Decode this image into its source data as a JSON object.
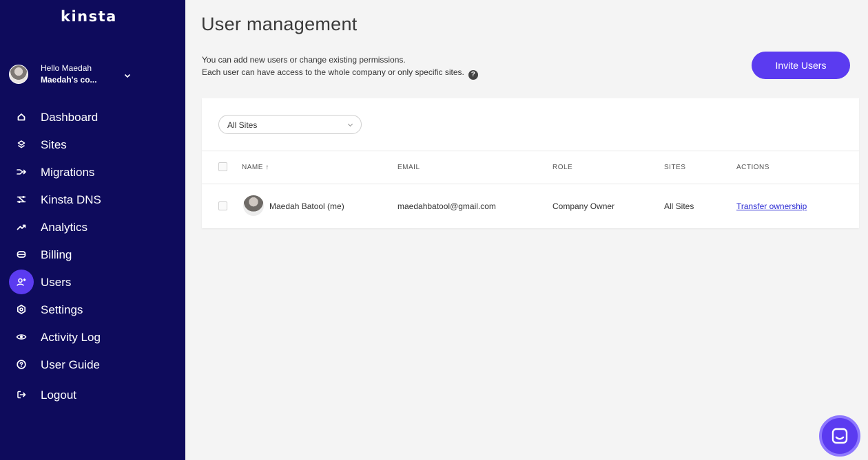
{
  "sidebar": {
    "logo": "kinsta",
    "account": {
      "greeting": "Hello Maedah",
      "company": "Maedah's co..."
    },
    "nav": [
      {
        "label": "Dashboard",
        "icon": "home-icon"
      },
      {
        "label": "Sites",
        "icon": "layers-icon"
      },
      {
        "label": "Migrations",
        "icon": "migrations-icon"
      },
      {
        "label": "Kinsta DNS",
        "icon": "dns-icon"
      },
      {
        "label": "Analytics",
        "icon": "trend-up-icon"
      },
      {
        "label": "Billing",
        "icon": "billing-icon"
      },
      {
        "label": "Users",
        "icon": "add-user-icon",
        "active": true
      },
      {
        "label": "Settings",
        "icon": "settings-icon"
      },
      {
        "label": "Activity Log",
        "icon": "eye-icon"
      },
      {
        "label": "User Guide",
        "icon": "help-circle-icon"
      },
      {
        "label": "Logout",
        "icon": "logout-icon"
      }
    ]
  },
  "main": {
    "title": "User management",
    "description": {
      "line1": "You can add new users or change existing permissions.",
      "line2": "Each user can have access to the whole company or only specific sites."
    },
    "help_glyph": "?",
    "invite_button": "Invite Users",
    "filter": {
      "selected": "All Sites"
    },
    "table": {
      "headers": {
        "name": "NAME",
        "sort_arrow": "↑",
        "email": "EMAIL",
        "role": "ROLE",
        "sites": "SITES",
        "actions": "ACTIONS"
      },
      "rows": [
        {
          "name": "Maedah Batool (me)",
          "email": "maedahbatool@gmail.com",
          "role": "Company Owner",
          "sites": "All Sites",
          "action": "Transfer ownership"
        }
      ]
    }
  },
  "colors": {
    "sidebar_bg": "#0e0b5c",
    "accent": "#5b3bf0",
    "page_bg": "#f4f4f4",
    "link": "#2d2dd4"
  }
}
